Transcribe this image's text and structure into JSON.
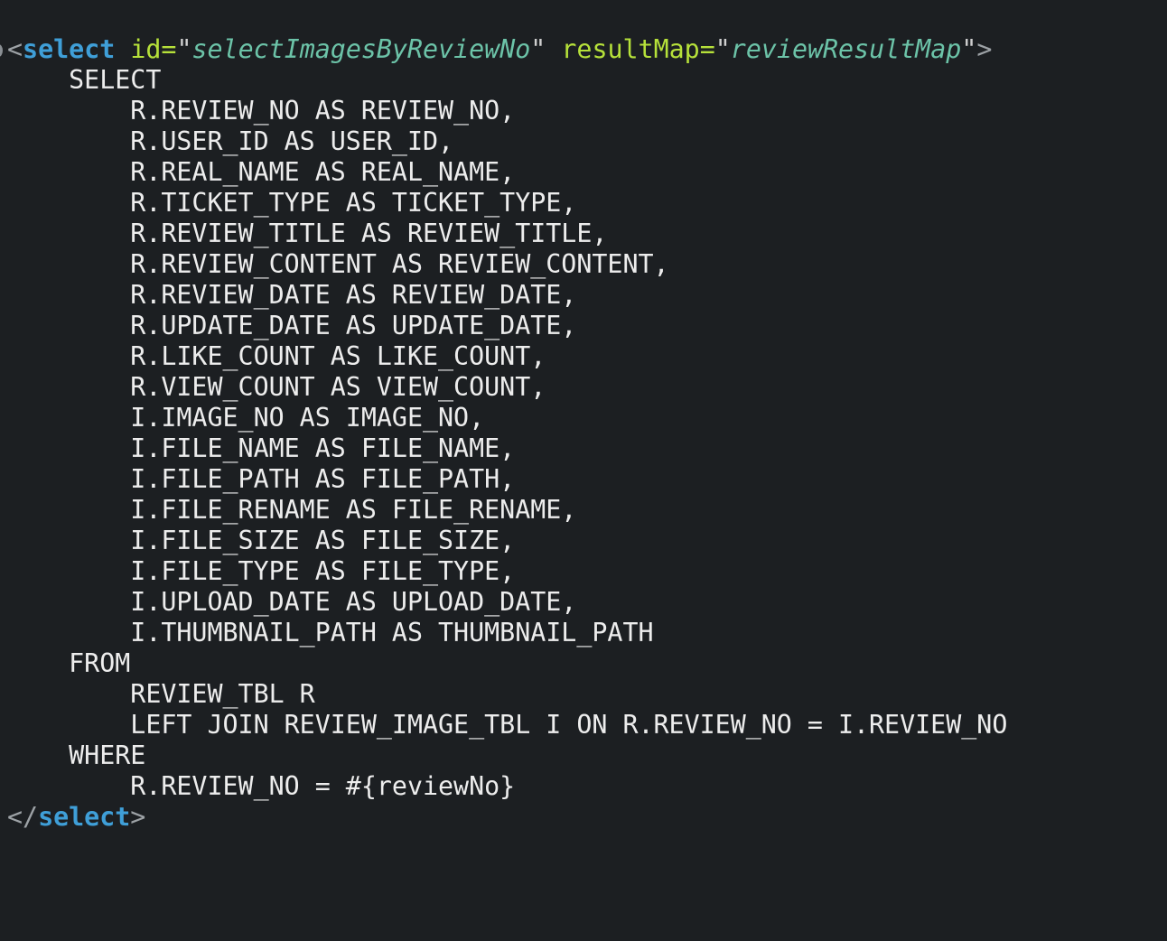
{
  "editor": {
    "colors": {
      "background": "#1c1f22",
      "tag": "#3f9fd8",
      "attribute": "#b6e13a",
      "attribute_value": "#6cc3a8",
      "text": "#ededed",
      "punctuation": "#9da2a6"
    },
    "open_tag": {
      "lt": "<",
      "name": "select",
      "attrs": [
        {
          "name": "id",
          "eq": "=",
          "q1": "\"",
          "value": "selectImagesByReviewNo",
          "q2": "\""
        },
        {
          "name": "resultMap",
          "eq": "=",
          "q1": "\"",
          "value": "reviewResultMap",
          "q2": "\""
        }
      ],
      "gt": ">"
    },
    "sql_lines": [
      "    SELECT",
      "        R.REVIEW_NO AS REVIEW_NO,",
      "        R.USER_ID AS USER_ID,",
      "        R.REAL_NAME AS REAL_NAME,",
      "        R.TICKET_TYPE AS TICKET_TYPE,",
      "        R.REVIEW_TITLE AS REVIEW_TITLE,",
      "        R.REVIEW_CONTENT AS REVIEW_CONTENT,",
      "        R.REVIEW_DATE AS REVIEW_DATE,",
      "        R.UPDATE_DATE AS UPDATE_DATE,",
      "        R.LIKE_COUNT AS LIKE_COUNT,",
      "        R.VIEW_COUNT AS VIEW_COUNT,",
      "        I.IMAGE_NO AS IMAGE_NO,",
      "        I.FILE_NAME AS FILE_NAME,",
      "        I.FILE_PATH AS FILE_PATH,",
      "        I.FILE_RENAME AS FILE_RENAME,",
      "        I.FILE_SIZE AS FILE_SIZE,",
      "        I.FILE_TYPE AS FILE_TYPE,",
      "        I.UPLOAD_DATE AS UPLOAD_DATE,",
      "        I.THUMBNAIL_PATH AS THUMBNAIL_PATH",
      "    FROM",
      "        REVIEW_TBL R",
      "        LEFT JOIN REVIEW_IMAGE_TBL I ON R.REVIEW_NO = I.REVIEW_NO",
      "    WHERE",
      "        R.REVIEW_NO = #{reviewNo}"
    ],
    "close_tag": {
      "lt_slash": "</",
      "name": "select",
      "gt": ">"
    }
  }
}
